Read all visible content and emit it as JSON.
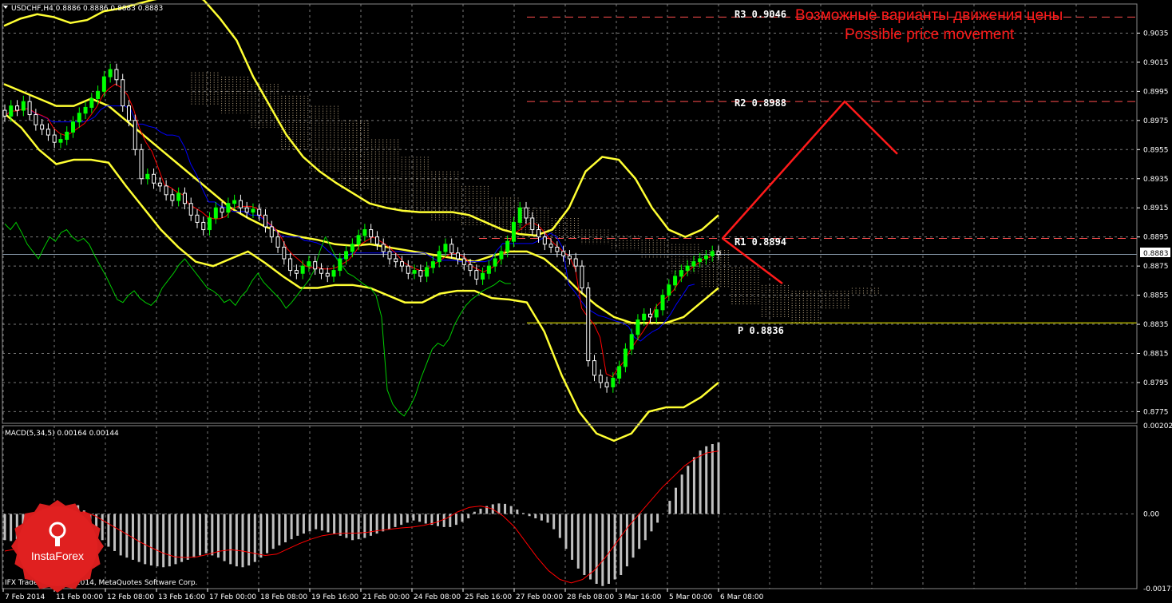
{
  "window": {
    "symbol_info": "USDCHF,H4  0.8886 0.8886 0.8883 0.8883",
    "footer": "IFX Trader, © 2001-2014, MetaQuotes Software Corp."
  },
  "logo": {
    "text": "InstaForex"
  },
  "colors": {
    "background": "#000000",
    "grid": "#777777",
    "bull_candle": "#00ff00",
    "bear_candle": "#ffffff",
    "bollinger": "#ffff33",
    "kijun": "#0000ff",
    "tenkan": "#ff0000",
    "chikou": "#00cc00",
    "cloud": "#ffe4b5",
    "level_line": "#ff4d4d",
    "pivot_line": "#ffff00",
    "projection": "#ff1a1a",
    "macd_hist": "#c0c0c0",
    "macd_signal": "#ff0000"
  },
  "chart_data": [
    {
      "type": "line",
      "panel": "price",
      "ylim": [
        0.8767,
        0.9055
      ],
      "y_ticks": [
        "0.9035",
        "0.9015",
        "0.8995",
        "0.8975",
        "0.8955",
        "0.8935",
        "0.8915",
        "0.8895",
        "0.8875",
        "0.8855",
        "0.8835",
        "0.8815",
        "0.8795",
        "0.8775"
      ],
      "current_price": "0.8883",
      "x_ticks": [
        "7 Feb 2014",
        "11 Feb 00:00",
        "12 Feb 08:00",
        "13 Feb 16:00",
        "17 Feb 00:00",
        "18 Feb 08:00",
        "19 Feb 16:00",
        "21 Feb 00:00",
        "24 Feb 08:00",
        "25 Feb 16:00",
        "27 Feb 00:00",
        "28 Feb 08:00",
        "3 Mar 16:00",
        "5 Mar 00:00",
        "6 Mar 08:00"
      ],
      "grid": true,
      "levels": [
        {
          "name": "R3",
          "value": 0.9046,
          "label": "R3  0.9046"
        },
        {
          "name": "R2",
          "value": 0.8988,
          "label": "R2  0.8988"
        },
        {
          "name": "R1",
          "value": 0.8894,
          "label": "R1  0.8894"
        },
        {
          "name": "P",
          "value": 0.8836,
          "label": "P  0.8836"
        }
      ],
      "annotations": [
        "Возможные варианты движения цены",
        "Possible price movement"
      ],
      "close": [
        0.8978,
        0.8985,
        0.8982,
        0.8988,
        0.8979,
        0.8972,
        0.8969,
        0.8965,
        0.896,
        0.8962,
        0.8967,
        0.8974,
        0.898,
        0.8984,
        0.899,
        0.8995,
        0.9005,
        0.901,
        0.9003,
        0.8985,
        0.8975,
        0.8955,
        0.8935,
        0.8938,
        0.8932,
        0.893,
        0.8924,
        0.892,
        0.8925,
        0.8918,
        0.891,
        0.8905,
        0.89,
        0.8908,
        0.8915,
        0.8912,
        0.8918,
        0.892,
        0.8915,
        0.8912,
        0.8914,
        0.891,
        0.8902,
        0.8895,
        0.8888,
        0.888,
        0.8872,
        0.887,
        0.8875,
        0.8878,
        0.8873,
        0.887,
        0.8868,
        0.8872,
        0.888,
        0.8885,
        0.889,
        0.8896,
        0.89,
        0.8895,
        0.889,
        0.8885,
        0.888,
        0.8878,
        0.8875,
        0.887,
        0.8872,
        0.8868,
        0.8874,
        0.8878,
        0.8885,
        0.889,
        0.8884,
        0.888,
        0.8876,
        0.8872,
        0.8866,
        0.887,
        0.8875,
        0.888,
        0.8885,
        0.8892,
        0.8905,
        0.8915,
        0.8908,
        0.89,
        0.8895,
        0.889,
        0.8888,
        0.8885,
        0.8882,
        0.888,
        0.8875,
        0.886,
        0.881,
        0.88,
        0.8795,
        0.8792,
        0.8798,
        0.8806,
        0.8818,
        0.8828,
        0.8838,
        0.8842,
        0.884,
        0.8845,
        0.8855,
        0.8862,
        0.8868,
        0.8872,
        0.8875,
        0.8878,
        0.888,
        0.8882,
        0.8885,
        0.8883
      ],
      "bollinger_upper": [
        0.904,
        0.9045,
        0.9048,
        0.9046,
        0.9042,
        0.9044,
        0.905,
        0.9052,
        0.9055,
        0.9058,
        0.906,
        0.9062,
        0.9058,
        0.9045,
        0.903,
        0.9005,
        0.8985,
        0.8965,
        0.895,
        0.894,
        0.8932,
        0.8925,
        0.8918,
        0.8915,
        0.8913,
        0.8912,
        0.8912,
        0.8912,
        0.891,
        0.8905,
        0.89,
        0.8897,
        0.8896,
        0.89,
        0.8915,
        0.894,
        0.895,
        0.8948,
        0.8935,
        0.8915,
        0.89,
        0.8895,
        0.89,
        0.891
      ],
      "bollinger_mid": [
        0.9,
        0.8995,
        0.899,
        0.8985,
        0.8985,
        0.899,
        0.8985,
        0.8975,
        0.8965,
        0.8955,
        0.8945,
        0.8935,
        0.8925,
        0.8915,
        0.8908,
        0.8902,
        0.8898,
        0.8895,
        0.8893,
        0.889,
        0.8889,
        0.889,
        0.8888,
        0.8886,
        0.8884,
        0.8882,
        0.888,
        0.8878,
        0.8882,
        0.8885,
        0.8885,
        0.888,
        0.887,
        0.8858,
        0.8848,
        0.884,
        0.8836,
        0.8836,
        0.8836,
        0.884,
        0.885,
        0.886
      ],
      "bollinger_lower": [
        0.898,
        0.897,
        0.8955,
        0.8945,
        0.8948,
        0.8948,
        0.8946,
        0.893,
        0.8915,
        0.89,
        0.8888,
        0.8878,
        0.8875,
        0.888,
        0.8885,
        0.8877,
        0.8868,
        0.886,
        0.886,
        0.8862,
        0.8862,
        0.886,
        0.8855,
        0.885,
        0.885,
        0.8856,
        0.8858,
        0.8858,
        0.8853,
        0.8852,
        0.885,
        0.883,
        0.88,
        0.8775,
        0.876,
        0.8755,
        0.876,
        0.8775,
        0.8778,
        0.8778,
        0.8785,
        0.8795
      ]
    },
    {
      "type": "bar",
      "panel": "indicator",
      "title": "MACD(5,34,5)  0.00164  0.00144",
      "ylim": [
        -0.00171,
        0.00202
      ],
      "y_ticks": [
        "0.00202",
        "0.00",
        "-0.00171"
      ],
      "histogram": [
        -0.0006,
        -0.00062,
        -0.00058,
        -0.00052,
        -0.00048,
        -0.00042,
        -0.00035,
        -0.00025,
        -0.00018,
        -0.0001,
        5e-05,
        0.00015,
        0.0002,
        8e-05,
        -0.0002,
        -0.00045,
        -0.0006,
        -0.00075,
        -0.00085,
        -0.00095,
        -0.001,
        -0.00105,
        -0.0011,
        -0.00115,
        -0.00118,
        -0.0012,
        -0.00122,
        -0.0012,
        -0.00115,
        -0.0011,
        -0.00105,
        -0.001,
        -0.00095,
        -0.0009,
        -0.00095,
        -0.001,
        -0.00108,
        -0.00115,
        -0.0012,
        -0.00122,
        -0.00118,
        -0.0011,
        -0.001,
        -0.0009,
        -0.0008,
        -0.00072,
        -0.00065,
        -0.00058,
        -0.0005,
        -0.00045,
        -0.0004,
        -0.00035,
        -0.00038,
        -0.00042,
        -0.00045,
        -0.0005,
        -0.00055,
        -0.0006,
        -0.00058,
        -0.00055,
        -0.0005,
        -0.00045,
        -0.0004,
        -0.00035,
        -0.0003,
        -0.00025,
        -0.0002,
        -0.00015,
        -0.00018,
        -0.00022,
        -0.00025,
        -0.00028,
        -0.0003,
        -0.0003,
        -0.00025,
        -0.00018,
        -0.0001,
        5e-05,
        0.00012,
        0.00018,
        0.00022,
        0.00024,
        0.00023,
        0.00018,
        0.0001,
        2e-05,
        -5e-05,
        -0.0001,
        -0.00015,
        -0.0002,
        -0.00035,
        -0.00055,
        -0.0008,
        -0.00105,
        -0.00125,
        -0.0014,
        -0.0015,
        -0.0016,
        -0.00165,
        -0.0016,
        -0.0015,
        -0.0014,
        -0.0012,
        -0.001,
        -0.0008,
        -0.0006,
        -0.0004,
        -0.0002,
        0.0,
        0.0003,
        0.0006,
        0.0009,
        0.0011,
        0.0013,
        0.00145,
        0.00155,
        0.0016,
        0.00164
      ],
      "signal": [
        -0.00085,
        -0.0008,
        -0.0007,
        -0.00055,
        -0.00035,
        -0.00015,
        0.0,
        5e-05,
        -5e-05,
        -0.0002,
        -0.00035,
        -0.0005,
        -0.00065,
        -0.00078,
        -0.0009,
        -0.00098,
        -0.001,
        -0.00098,
        -0.00092,
        -0.00085,
        -0.00082,
        -0.00085,
        -0.0009,
        -0.00095,
        -0.00092,
        -0.0008,
        -0.00068,
        -0.00058,
        -0.0005,
        -0.00046,
        -0.00044,
        -0.00044,
        -0.00042,
        -0.00038,
        -0.00035,
        -0.00032,
        -0.0003,
        -0.00026,
        -0.0002,
        -0.0001,
        5e-05,
        0.00015,
        0.00018,
        0.00012,
        -5e-05,
        -0.0003,
        -0.00065,
        -0.001,
        -0.0013,
        -0.0015,
        -0.00158,
        -0.0015,
        -0.0013,
        -0.001,
        -0.00065,
        -0.0003,
        0.0,
        0.0003,
        0.0006,
        0.00085,
        0.0011,
        0.00128,
        0.0014,
        0.00144
      ]
    }
  ]
}
